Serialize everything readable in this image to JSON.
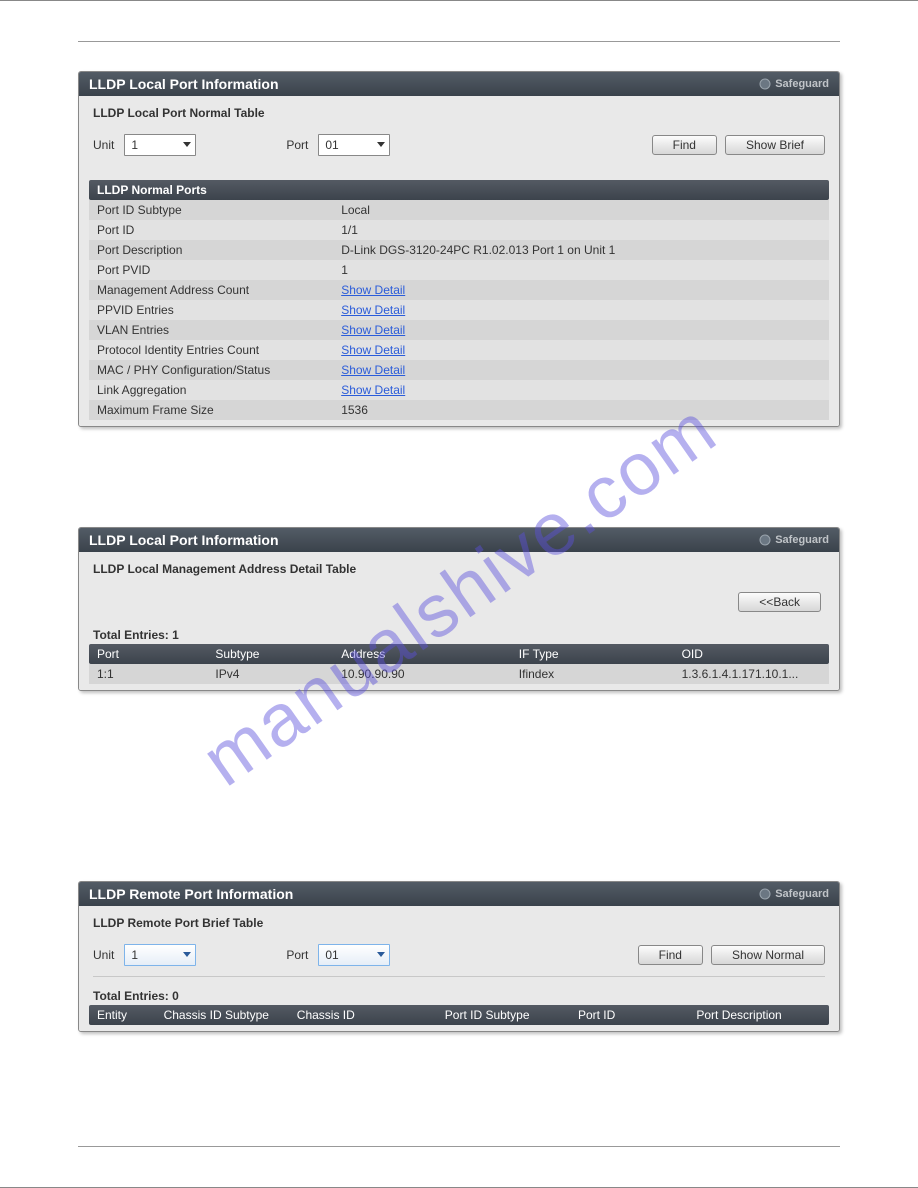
{
  "watermark": "manualshive.com",
  "panel1": {
    "title": "LLDP Local Port Information",
    "safeguard": "Safeguard",
    "subhead": "LLDP Local Port Normal Table",
    "unit_label": "Unit",
    "unit_value": "1",
    "port_label": "Port",
    "port_value": "01",
    "btn_find": "Find",
    "btn_brief": "Show Brief",
    "section": "LLDP Normal Ports",
    "rows": [
      {
        "k": "Port ID Subtype",
        "v": "Local",
        "link": false
      },
      {
        "k": "Port ID",
        "v": "1/1",
        "link": false
      },
      {
        "k": "Port Description",
        "v": "D-Link DGS-3120-24PC R1.02.013 Port 1 on Unit 1",
        "link": false
      },
      {
        "k": "Port PVID",
        "v": "1",
        "link": false
      },
      {
        "k": "Management Address Count",
        "v": "Show Detail",
        "link": true
      },
      {
        "k": "PPVID Entries",
        "v": "Show Detail",
        "link": true
      },
      {
        "k": "VLAN Entries",
        "v": "Show Detail",
        "link": true
      },
      {
        "k": "Protocol Identity Entries Count",
        "v": "Show Detail",
        "link": true
      },
      {
        "k": "MAC / PHY Configuration/Status",
        "v": "Show Detail",
        "link": true
      },
      {
        "k": "Link Aggregation",
        "v": "Show Detail",
        "link": true
      },
      {
        "k": "Maximum Frame Size",
        "v": "1536",
        "link": false
      }
    ]
  },
  "panel2": {
    "title": "LLDP Local Port Information",
    "safeguard": "Safeguard",
    "subhead": "LLDP Local Management Address Detail Table",
    "btn_back": "<<Back",
    "total": "Total Entries: 1",
    "headers": [
      "Port",
      "Subtype",
      "Address",
      "IF Type",
      "OID"
    ],
    "row": [
      "1:1",
      "IPv4",
      "10.90.90.90",
      "Ifindex",
      "1.3.6.1.4.1.171.10.1..."
    ]
  },
  "panel3": {
    "title": "LLDP Remote Port Information",
    "safeguard": "Safeguard",
    "subhead": "LLDP Remote Port Brief Table",
    "unit_label": "Unit",
    "unit_value": "1",
    "port_label": "Port",
    "port_value": "01",
    "btn_find": "Find",
    "btn_normal": "Show Normal",
    "total": "Total Entries: 0",
    "headers": [
      "Entity",
      "Chassis ID Subtype",
      "Chassis ID",
      "Port ID Subtype",
      "Port ID",
      "Port Description"
    ]
  }
}
